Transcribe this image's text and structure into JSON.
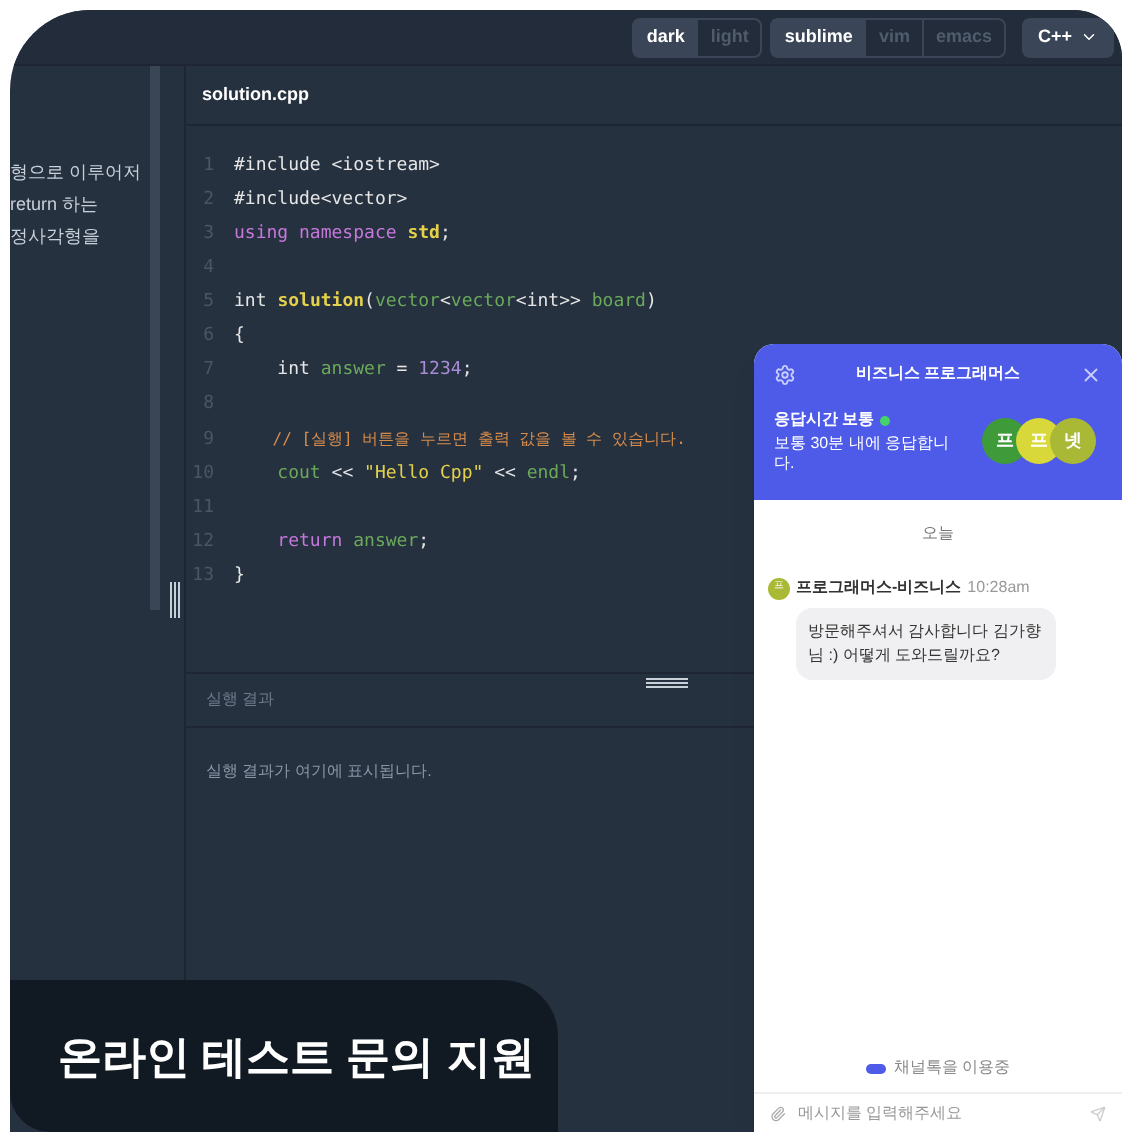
{
  "toolbar": {
    "groups": [
      {
        "options": [
          {
            "label": "dark",
            "selected": true
          },
          {
            "label": "light",
            "selected": false
          }
        ]
      },
      {
        "options": [
          {
            "label": "sublime",
            "selected": true
          },
          {
            "label": "vim",
            "selected": false
          },
          {
            "label": "emacs",
            "selected": false
          }
        ]
      }
    ],
    "language": "C++"
  },
  "problem_text": [
    "형으로 이루어저",
    "return 하는",
    "정사각형을"
  ],
  "editor": {
    "file_tab": "solution.cpp",
    "lines": [
      {
        "number": "1",
        "tokens": [
          {
            "kind": "plain",
            "text": "#include <iostream>"
          }
        ]
      },
      {
        "number": "2",
        "tokens": [
          {
            "kind": "plain",
            "text": "#include<vector>"
          }
        ]
      },
      {
        "number": "3",
        "tokens": [
          {
            "kind": "keyword",
            "text": "using namespace "
          },
          {
            "kind": "name",
            "text": "std"
          },
          {
            "kind": "plain",
            "text": ";"
          }
        ]
      },
      {
        "number": "4"
      },
      {
        "number": "5",
        "tokens": [
          {
            "kind": "plain",
            "text": "int "
          },
          {
            "kind": "name",
            "text": "solution"
          },
          {
            "kind": "plain",
            "text": "("
          },
          {
            "kind": "var",
            "text": "vector"
          },
          {
            "kind": "plain",
            "text": "<"
          },
          {
            "kind": "var",
            "text": "vector"
          },
          {
            "kind": "plain",
            "text": "<int>> "
          },
          {
            "kind": "var",
            "text": "board"
          },
          {
            "kind": "plain",
            "text": ")"
          }
        ]
      },
      {
        "number": "6",
        "tokens": [
          {
            "kind": "plain",
            "text": "{"
          }
        ]
      },
      {
        "number": "7",
        "tokens": [
          {
            "kind": "plain",
            "text": "    int "
          },
          {
            "kind": "var",
            "text": "answer"
          },
          {
            "kind": "plain",
            "text": " = "
          },
          {
            "kind": "number",
            "text": "1234"
          },
          {
            "kind": "plain",
            "text": ";"
          }
        ]
      },
      {
        "number": "8"
      },
      {
        "number": "9",
        "tokens": [
          {
            "kind": "comment",
            "text": "    // [실행] 버튼을 누르면 출력 값을 볼 수 있습니다."
          }
        ]
      },
      {
        "number": "10",
        "tokens": [
          {
            "kind": "var",
            "text": "    cout"
          },
          {
            "kind": "plain",
            "text": " << "
          },
          {
            "kind": "string",
            "text": "\"Hello Cpp\""
          },
          {
            "kind": "plain",
            "text": " << "
          },
          {
            "kind": "var",
            "text": "endl"
          },
          {
            "kind": "plain",
            "text": ";"
          }
        ]
      },
      {
        "number": "11"
      },
      {
        "number": "12",
        "tokens": [
          {
            "kind": "keyword",
            "text": "    return "
          },
          {
            "kind": "var",
            "text": "answer"
          },
          {
            "kind": "plain",
            "text": ";"
          }
        ]
      },
      {
        "number": "13",
        "tokens": [
          {
            "kind": "plain",
            "text": "}"
          }
        ]
      }
    ]
  },
  "result": {
    "title": "실행 결과",
    "output": "실행 결과가 여기에 표시됩니다."
  },
  "banner": "온라인 테스트 문의 지원",
  "chat": {
    "title": "비즈니스 프로그래머스",
    "status": "응답시간 보통",
    "online": true,
    "response_note": "보통 30분 내에 응답합니다.",
    "team": [
      {
        "initial": "프",
        "color": "#3f9b3a"
      },
      {
        "initial": "프",
        "color": "#d8d83a"
      },
      {
        "initial": "넷",
        "color": "#a9b935"
      }
    ],
    "date": "오늘",
    "messages": [
      {
        "avatar": "프",
        "sender": "프로그래머스-비즈니스",
        "time": "10:28am",
        "text": "방문해주셔서 감사합니다 김가향님 :) 어떻게 도와드릴까요?"
      }
    ],
    "powered_by": "채널톡을 이용중",
    "input_placeholder": "메시지를 입력해주세요"
  }
}
